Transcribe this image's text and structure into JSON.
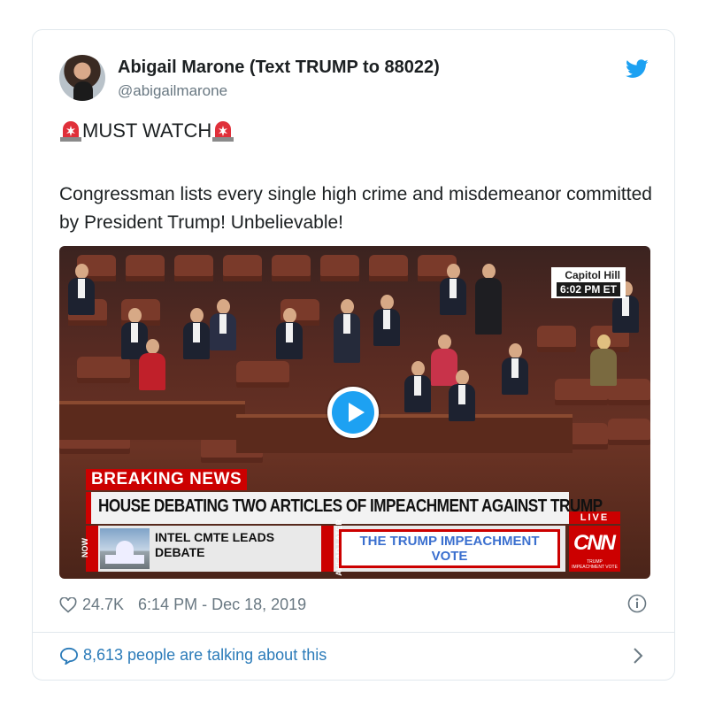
{
  "tweet": {
    "author_name": "Abigail Marone (Text TRUMP to 88022)",
    "handle": "@abigailmarone",
    "headline": "MUST WATCH",
    "body": "Congressman lists every single high crime and misdemeanor committed by President Trump! Unbelievable!",
    "likes": "24.7K",
    "timestamp": "6:14 PM - Dec 18, 2019",
    "talking": "8,613 people are talking about this"
  },
  "video": {
    "location": "Capitol Hill",
    "time": "6:02 PM ET",
    "breaking_label": "BREAKING NEWS",
    "chyron": "HOUSE DEBATING TWO ARTICLES OF IMPEACHMENT AGAINST TRUMP",
    "live_label": "LIVE",
    "now_label": "NOW",
    "now_story": "INTEL CMTE LEADS DEBATE",
    "ahead_label": "AHEAD LATER",
    "ahead_story": "THE TRUMP IMPEACHMENT VOTE",
    "network": "CNN",
    "network_small": "TRUMP IMPEACHMENT VOTE"
  },
  "icons": {
    "brand": "twitter-bird-icon",
    "siren": "rotating-light-icon",
    "heart": "heart-icon",
    "info": "info-icon",
    "comment": "comment-bubble-icon",
    "chevron": "chevron-right-icon",
    "play": "play-icon"
  },
  "colors": {
    "twitter_blue": "#1da1f2",
    "link_blue": "#2b7bb9",
    "cnn_red": "#cc0000",
    "secondary_text": "#697882"
  }
}
